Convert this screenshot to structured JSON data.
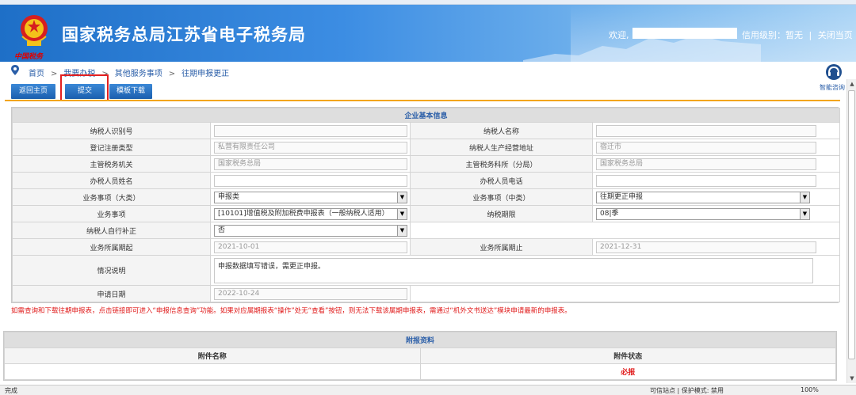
{
  "header": {
    "emblem_text": "中国税务",
    "site_title": "国家税务总局江苏省电子税务局",
    "welcome": "欢迎,",
    "credit_text": "信用级别：暂无",
    "close_link": "关闭当页",
    "separator": "|"
  },
  "breadcrumb": {
    "items": [
      "首页",
      "我要办税",
      "其他服务事项",
      "往期申报更正"
    ],
    "separator": ">"
  },
  "consult": {
    "label": "智能咨询"
  },
  "toolbar": {
    "back_label": "返回主页",
    "submit_label": "提交",
    "template_label": "模板下载"
  },
  "form": {
    "section_title": "企业基本信息",
    "rows": {
      "taxpayer_id_label": "纳税人识别号",
      "taxpayer_id_value": "",
      "taxpayer_name_label": "纳税人名称",
      "taxpayer_name_value": "",
      "reg_type_label": "登记注册类型",
      "reg_type_value": "私营有限责任公司",
      "address_label": "纳税人生产经营地址",
      "address_value": "宿迁市",
      "tax_office_label": "主管税务机关",
      "tax_office_value": "国家税务总局",
      "tax_section_label": "主管税务科所（分局）",
      "tax_section_value": "国家税务总局",
      "handler_label": "办税人员姓名",
      "handler_value": "",
      "phone_label": "办税人员电话",
      "phone_value": "",
      "biz_major_label": "业务事项（大类）",
      "biz_major_value": "申报类",
      "biz_mid_label": "业务事项（中类）",
      "biz_mid_value": "往期更正申报",
      "biz_item_label": "业务事项",
      "biz_item_value": "[10101]增值税及附加税费申报表（一般纳税人适用）",
      "period_label": "纳税期限",
      "period_value": "08|季",
      "self_correct_label": "纳税人自行补正",
      "self_correct_value": "否",
      "start_label": "业务所属期起",
      "start_value": "2021-10-01",
      "end_label": "业务所属期止",
      "end_value": "2021-12-31",
      "desc_label": "情况说明",
      "desc_value": "申报数据填写错误，需更正申报。",
      "apply_date_label": "申请日期",
      "apply_date_value": "2022-10-24"
    }
  },
  "notice": "如需查询和下载往期申报表，点击链接即可进入“申报信息查询”功能。如果对应属期报表“操作”处无“查看”按钮，则无法下载该属期申报表，需通过“机外文书送达”模块申请最新的申报表。",
  "attachments": {
    "section_title": "附报资料",
    "col_name": "附件名称",
    "col_status": "附件状态",
    "row_status": "必报"
  },
  "statusbar": {
    "left": "完成",
    "mid": "可信站点 | 保护模式: 禁用",
    "zoom": "100%"
  },
  "colors": {
    "banner": "#1e6fc7",
    "button": "#1b5fae",
    "accent_line": "#f3a51d",
    "highlight_box": "#e32020",
    "notice": "#e01a1a",
    "link": "#2a5ea8"
  }
}
